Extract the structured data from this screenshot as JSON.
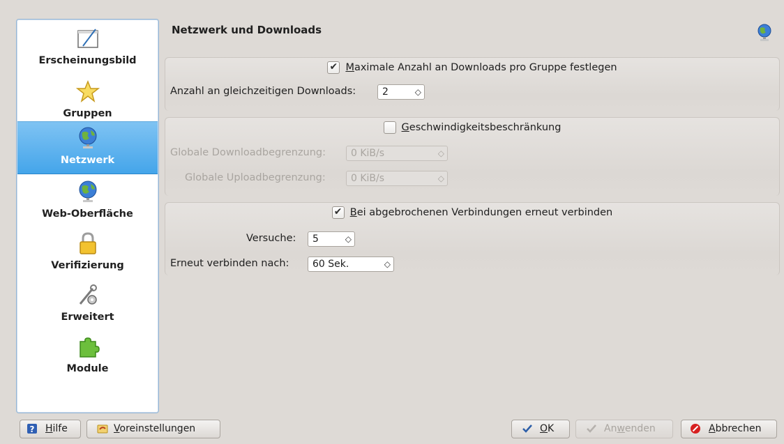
{
  "sidebar": {
    "items": [
      {
        "label": "Erscheinungsbild",
        "icon": "appearance-icon"
      },
      {
        "label": "Gruppen",
        "icon": "star-icon"
      },
      {
        "label": "Netzwerk",
        "icon": "globe-icon"
      },
      {
        "label": "Web-Oberfläche",
        "icon": "globe-icon"
      },
      {
        "label": "Verifizierung",
        "icon": "lock-icon"
      },
      {
        "label": "Erweitert",
        "icon": "tools-icon"
      },
      {
        "label": "Module",
        "icon": "puzzle-icon"
      }
    ],
    "active_index": 2
  },
  "header": {
    "title": "Netzwerk und Downloads",
    "icon": "globe-icon"
  },
  "group_downloads": {
    "checkbox": {
      "pre": "",
      "accel": "M",
      "post": "aximale Anzahl an Downloads pro Gruppe festlegen",
      "checked": true
    },
    "simultaneous_label": "Anzahl an gleichzeitigen Downloads:",
    "simultaneous_value": "2"
  },
  "group_speed": {
    "checkbox": {
      "pre": "",
      "accel": "G",
      "post": "eschwindigkeitsbeschränkung",
      "checked": false
    },
    "download_label": "Globale Downloadbegrenzung:",
    "download_value": "0 KiB/s",
    "upload_label": "Globale Uploadbegrenzung:",
    "upload_value": "0 KiB/s"
  },
  "group_reconnect": {
    "checkbox": {
      "pre": "",
      "accel": "B",
      "post": "ei abgebrochenen Verbindungen erneut verbinden",
      "checked": true
    },
    "attempts_label": "Versuche:",
    "attempts_value": "5",
    "delay_label": "Erneut verbinden nach:",
    "delay_value": "60 Sek."
  },
  "buttons": {
    "help": {
      "accel": "H",
      "rest": "ilfe"
    },
    "defaults": {
      "accel": "V",
      "rest": "oreinstellungen"
    },
    "ok": {
      "accel": "O",
      "rest": "K"
    },
    "apply": {
      "pre": "An",
      "accel": "w",
      "rest": "enden"
    },
    "cancel": {
      "accel": "A",
      "rest": "bbrechen"
    }
  },
  "colors": {
    "accent": "#44a5ea",
    "disabled_text": "#a9a5a0"
  }
}
